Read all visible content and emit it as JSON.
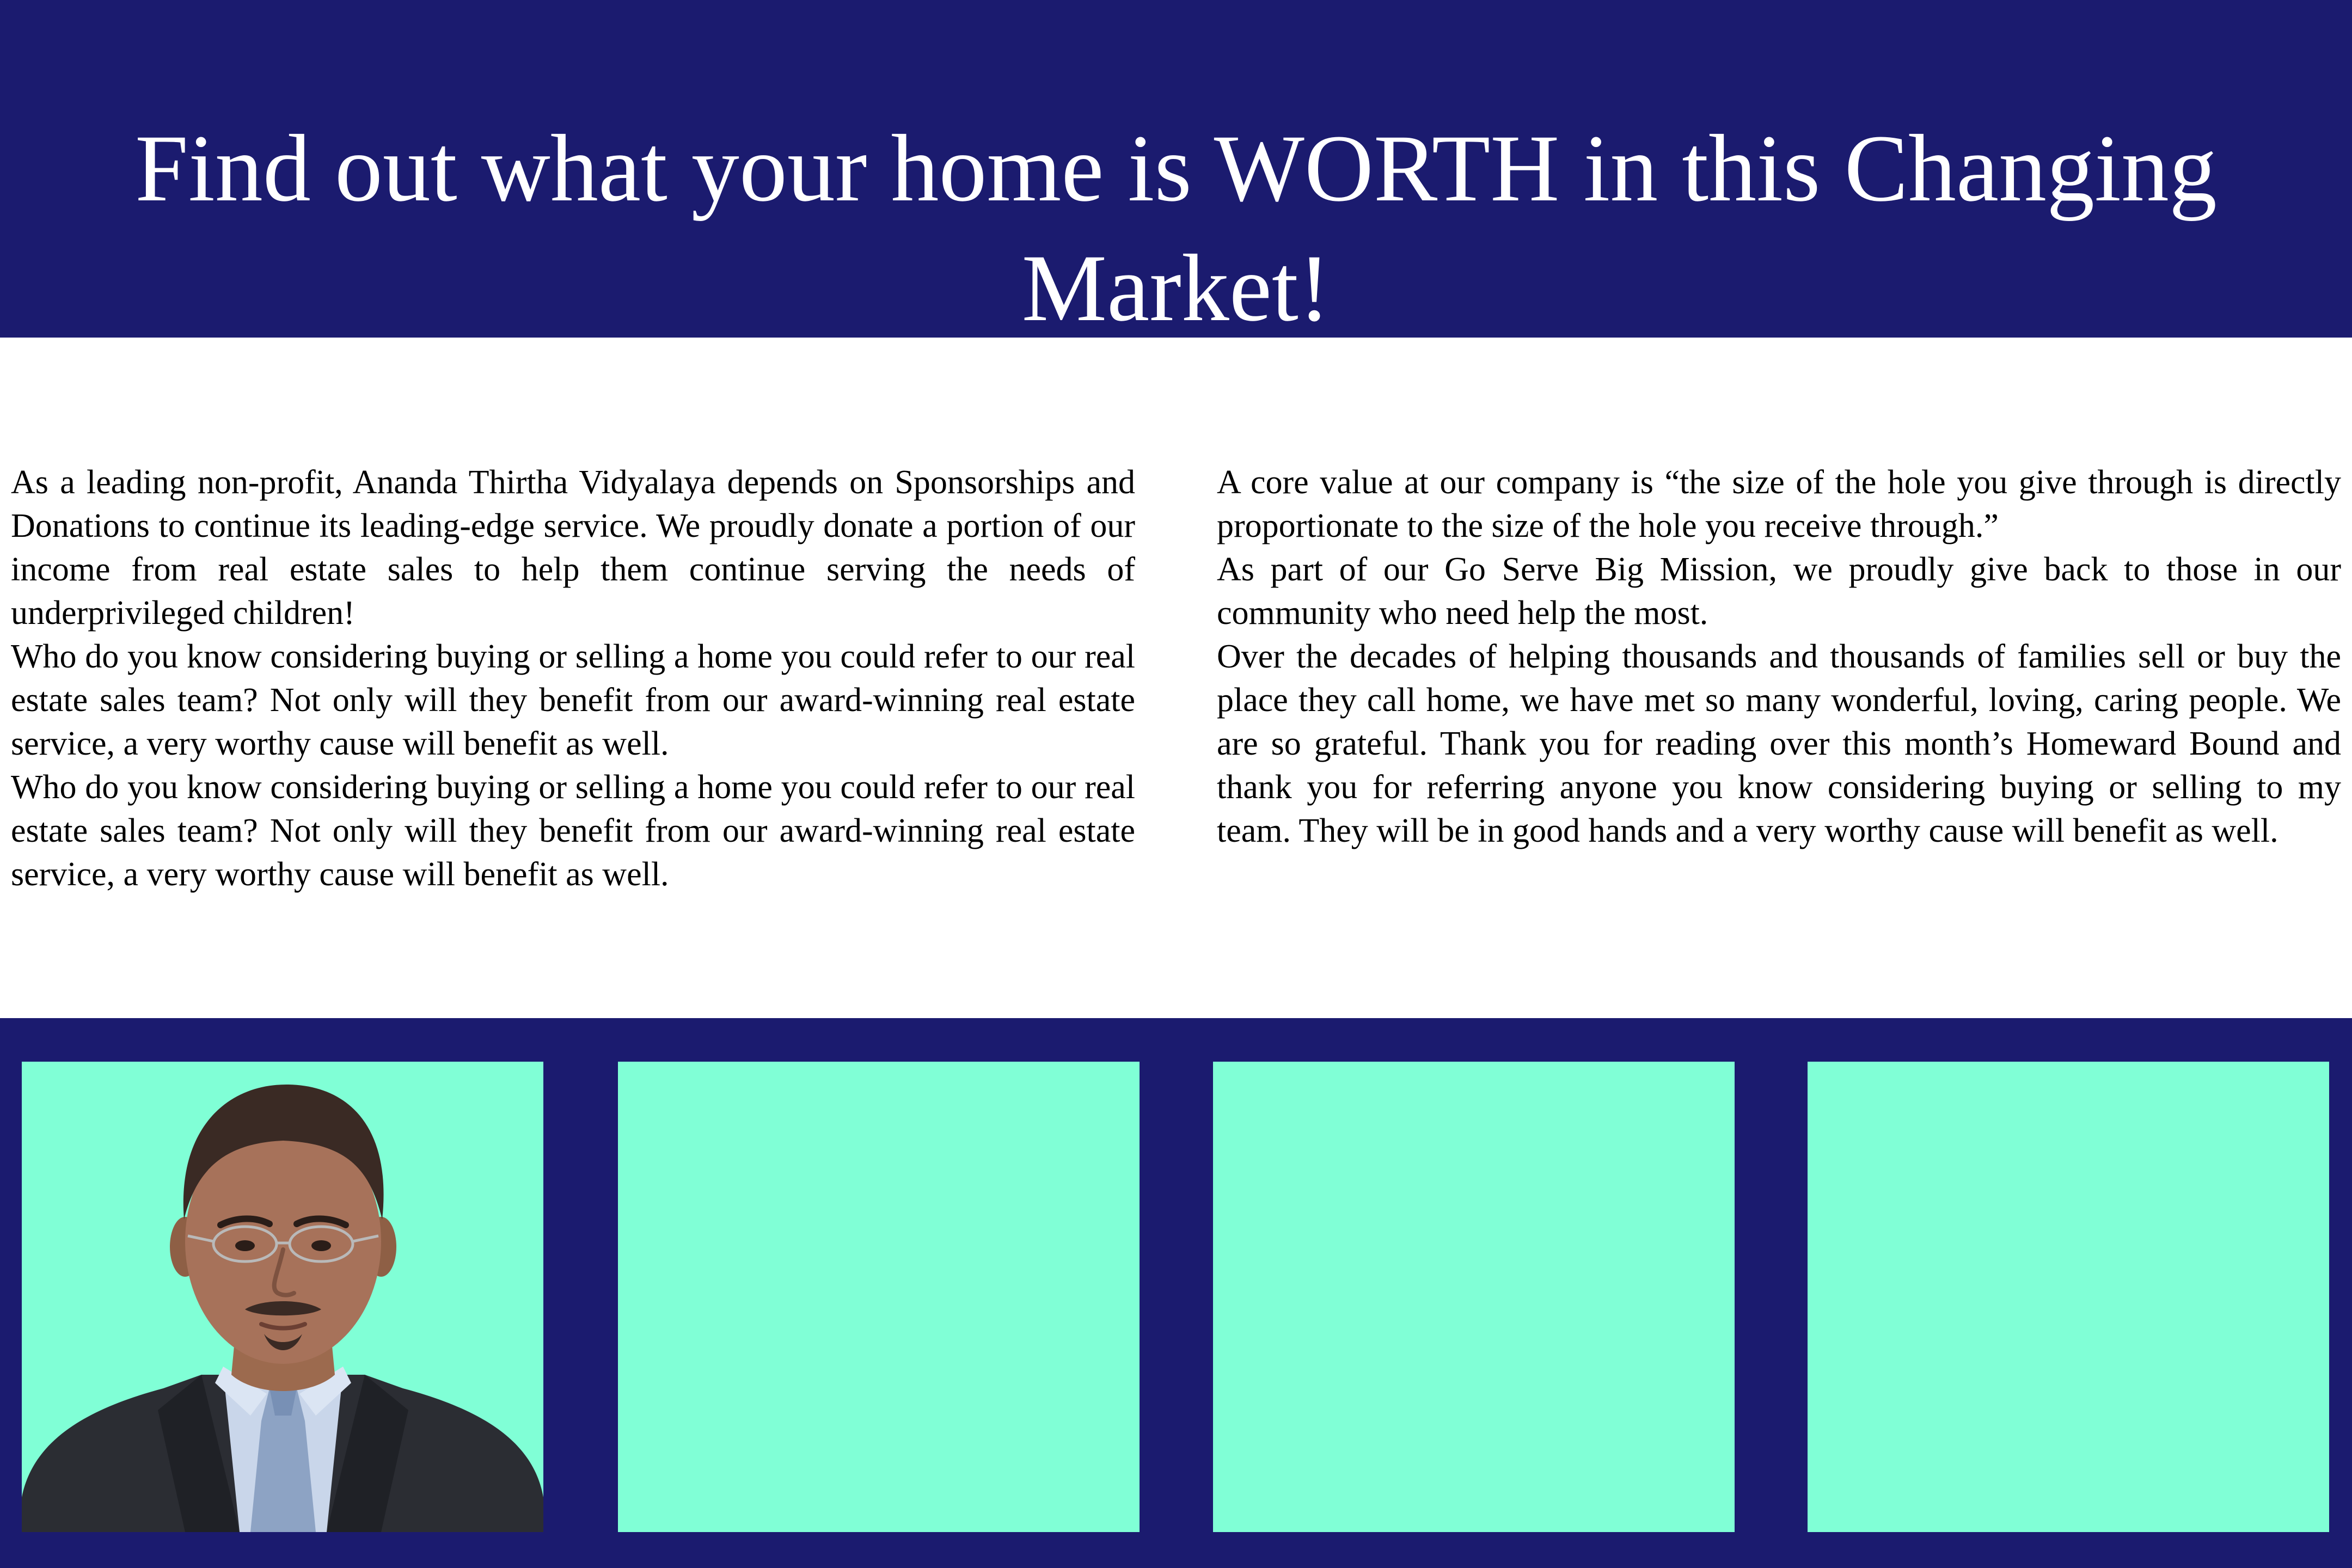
{
  "header": {
    "title": "Find out what your home is WORTH in this Changing Market!"
  },
  "left_column": {
    "paragraphs": [
      "As a leading non-profit, Ananda Thirtha Vidyalaya depends on Sponsorships and Donations to continue its leading-edge service. We proudly donate a portion of our income from real estate sales to help them continue serving the needs of underprivileged children!",
      "Who do you know considering buying or selling a home you could refer to our real estate sales team? Not only will they benefit from our award-winning real estate service, a very worthy cause will benefit as well.",
      "Who do you know considering buying or selling a home you could refer to our real estate sales team? Not only will they benefit from our award-winning real estate service, a very worthy cause will benefit as well."
    ]
  },
  "right_column": {
    "paragraphs": [
      "A core value at our company is “the size of the hole you give through is directly proportionate to the size of the hole you receive through.”",
      "As part of our Go Serve Big Mission, we proudly give back to those in our community who need help the most.",
      "Over the decades of helping thousands and thousands of families sell or buy the place they call home, we have met so many wonderful, loving, caring people. We are so grateful. Thank you for reading over this month’s Homeward Bound and thank you for referring anyone you know considering buying or selling to my team. They will be in good hands and a very worthy cause will benefit as well."
    ]
  },
  "colors": {
    "navy": "#1b1b6f",
    "tile": "#80ffd6",
    "text_dark": "#000000",
    "text_light": "#ffffff"
  },
  "footer": {
    "tiles": [
      {
        "content": "agent-portrait"
      },
      {
        "content": "empty"
      },
      {
        "content": "empty"
      },
      {
        "content": "empty"
      }
    ]
  }
}
